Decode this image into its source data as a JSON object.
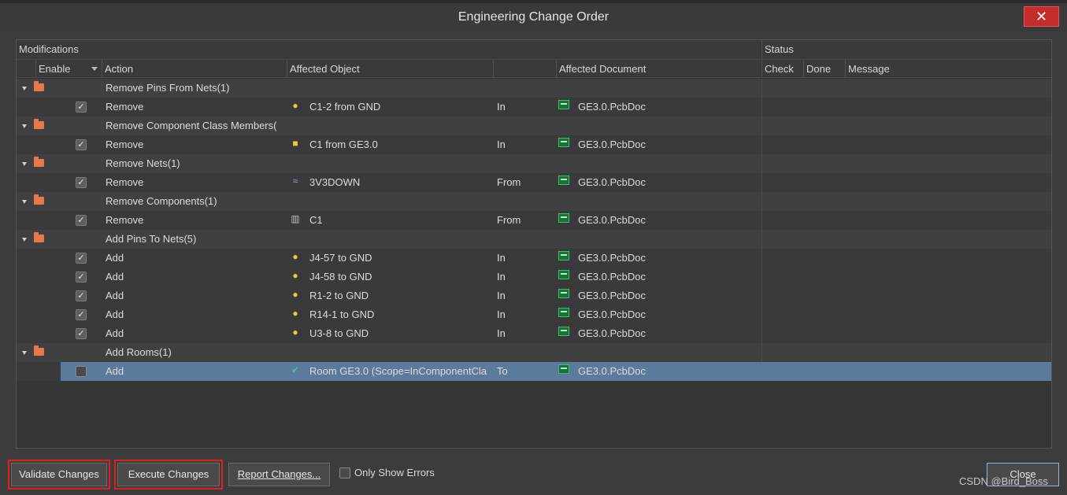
{
  "window": {
    "title": "Engineering Change Order",
    "close_glyph": "✕"
  },
  "headers": {
    "modifications": "Modifications",
    "status": "Status",
    "enable": "Enable",
    "action": "Action",
    "affected_object": "Affected Object",
    "affected_document": "Affected Document",
    "check": "Check",
    "done": "Done",
    "message": "Message"
  },
  "groups": [
    {
      "label": "Remove Pins From Nets(1)",
      "items": [
        {
          "action": "Remove",
          "object": "C1-2 from GND",
          "icon": "pin-icon",
          "dir": "In",
          "document": "GE3.0.PcbDoc",
          "checked": true
        }
      ]
    },
    {
      "label": "Remove Component Class Members(",
      "items": [
        {
          "action": "Remove",
          "object": "C1 from GE3.0",
          "icon": "component-class-icon",
          "dir": "In",
          "document": "GE3.0.PcbDoc",
          "checked": true
        }
      ]
    },
    {
      "label": "Remove Nets(1)",
      "items": [
        {
          "action": "Remove",
          "object": "3V3DOWN",
          "icon": "net-icon",
          "dir": "From",
          "document": "GE3.0.PcbDoc",
          "checked": true
        }
      ]
    },
    {
      "label": "Remove Components(1)",
      "items": [
        {
          "action": "Remove",
          "object": "C1",
          "icon": "component-icon",
          "dir": "From",
          "document": "GE3.0.PcbDoc",
          "checked": true
        }
      ]
    },
    {
      "label": "Add Pins To Nets(5)",
      "items": [
        {
          "action": "Add",
          "object": "J4-57 to GND",
          "icon": "pin-icon",
          "dir": "In",
          "document": "GE3.0.PcbDoc",
          "checked": true
        },
        {
          "action": "Add",
          "object": "J4-58 to GND",
          "icon": "pin-icon",
          "dir": "In",
          "document": "GE3.0.PcbDoc",
          "checked": true
        },
        {
          "action": "Add",
          "object": "R1-2 to GND",
          "icon": "pin-icon",
          "dir": "In",
          "document": "GE3.0.PcbDoc",
          "checked": true
        },
        {
          "action": "Add",
          "object": "R14-1 to GND",
          "icon": "pin-icon",
          "dir": "In",
          "document": "GE3.0.PcbDoc",
          "checked": true
        },
        {
          "action": "Add",
          "object": "U3-8 to GND",
          "icon": "pin-icon",
          "dir": "In",
          "document": "GE3.0.PcbDoc",
          "checked": true
        }
      ]
    },
    {
      "label": "Add Rooms(1)",
      "items": [
        {
          "action": "Add",
          "object": "Room GE3.0 (Scope=InComponentCla",
          "icon": "room-icon",
          "dir": "To",
          "document": "GE3.0.PcbDoc",
          "checked": false,
          "selected": true
        }
      ]
    }
  ],
  "footer": {
    "validate": "Validate Changes",
    "execute": "Execute Changes",
    "report": "Report Changes...",
    "only_errors": "Only Show Errors",
    "close": "Close",
    "watermark": "CSDN @Bird_Boss"
  },
  "colors": {
    "selection": "#5b7a9c",
    "highlight_outline": "#e02020",
    "folder": "#e8784a"
  }
}
